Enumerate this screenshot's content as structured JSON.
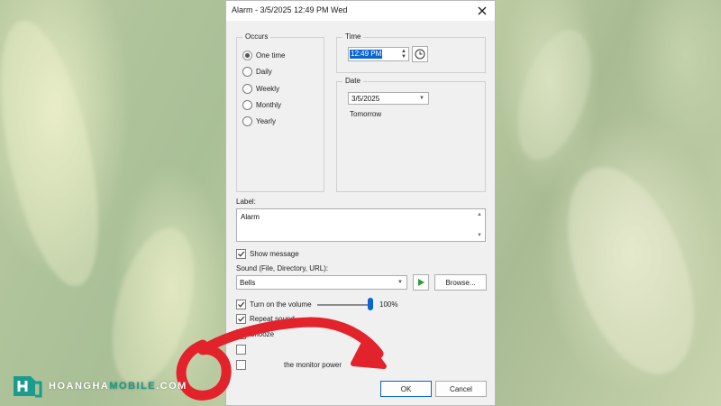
{
  "dialog": {
    "title": "Alarm - 3/5/2025 12:49 PM Wed"
  },
  "occurs": {
    "title": "Occurs",
    "options": [
      "One time",
      "Daily",
      "Weekly",
      "Monthly",
      "Yearly"
    ],
    "selected": "One time"
  },
  "time": {
    "title": "Time",
    "value": "12:49 PM"
  },
  "date": {
    "title": "Date",
    "value": "3/5/2025",
    "relative": "Tomorrow"
  },
  "label": {
    "title": "Label:",
    "value": "Alarm"
  },
  "show_message": {
    "label": "Show message",
    "checked": true
  },
  "sound": {
    "title": "Sound (File, Directory, URL):",
    "value": "Bells",
    "browse_label": "Browse..."
  },
  "volume": {
    "label": "Turn on the volume",
    "checked": true,
    "percent_label": "100%",
    "level": 1.0
  },
  "repeat_sound": {
    "label": "Repeat sound",
    "checked": true
  },
  "snooze": {
    "label": "Snooze",
    "checked": true
  },
  "monitor": {
    "label": "the monitor power"
  },
  "buttons": {
    "ok": "OK",
    "cancel": "Cancel"
  },
  "watermark": {
    "part1": "HOANGHA",
    "part2": "MOBILE",
    "part3": ".COM"
  },
  "colors": {
    "accent": "#0a64d2",
    "play": "#2e9c3a",
    "arrow": "#e3232b",
    "logo": "#1a9b8c"
  }
}
